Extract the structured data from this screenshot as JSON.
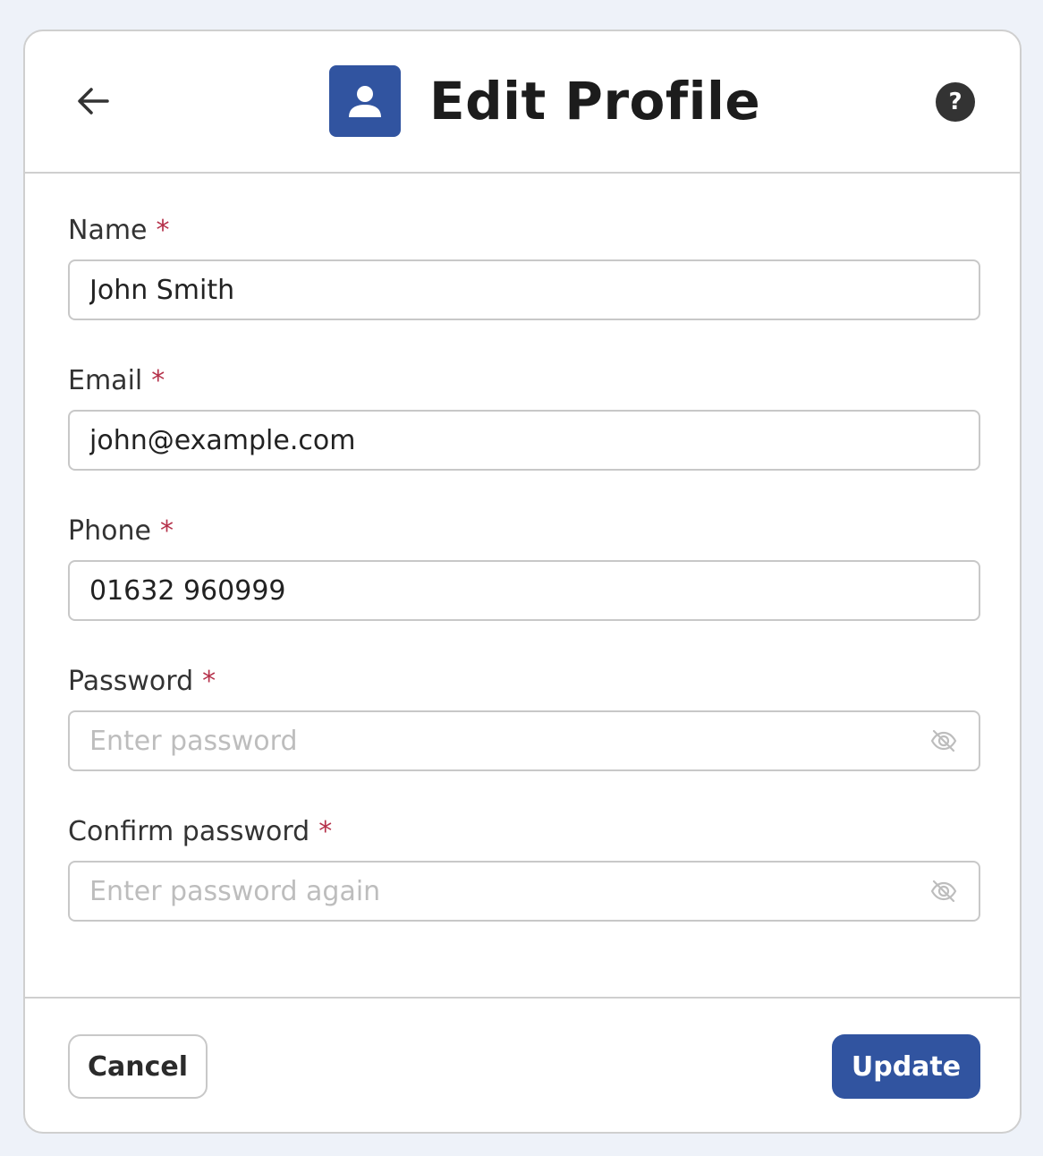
{
  "header": {
    "title": "Edit Profile",
    "back_icon": "arrow-left-icon",
    "title_icon": "user-icon",
    "help_label": "?"
  },
  "form": {
    "required_mark": "*",
    "name": {
      "label": "Name",
      "value": "John Smith",
      "placeholder": ""
    },
    "email": {
      "label": "Email",
      "value": "john@example.com",
      "placeholder": ""
    },
    "phone": {
      "label": "Phone",
      "value": "01632 960999",
      "placeholder": ""
    },
    "password": {
      "label": "Password",
      "value": "",
      "placeholder": "Enter password",
      "toggle_icon": "eye-off-icon"
    },
    "confirm_password": {
      "label": "Confirm password",
      "value": "",
      "placeholder": "Enter password again",
      "toggle_icon": "eye-off-icon"
    }
  },
  "footer": {
    "cancel_label": "Cancel",
    "update_label": "Update"
  },
  "colors": {
    "accent": "#3154a0",
    "required": "#b5314a",
    "background": "#eef2f9"
  }
}
